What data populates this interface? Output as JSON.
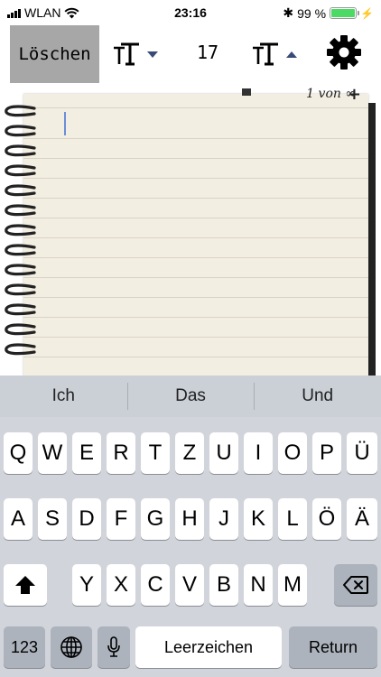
{
  "status_bar": {
    "carrier": "WLAN",
    "time": "23:16",
    "battery_percent": "99 %",
    "battery_level": 0.99
  },
  "toolbar": {
    "clear_label": "Löschen",
    "font_size": "17"
  },
  "notebook": {
    "page_indicator": "1 von ∞",
    "next_page": "+"
  },
  "keyboard": {
    "suggestions": [
      "Ich",
      "Das",
      "Und"
    ],
    "row1": [
      "Q",
      "W",
      "E",
      "R",
      "T",
      "Z",
      "U",
      "I",
      "O",
      "P",
      "Ü"
    ],
    "row2": [
      "A",
      "S",
      "D",
      "F",
      "G",
      "H",
      "J",
      "K",
      "L",
      "Ö",
      "Ä"
    ],
    "row3": [
      "Y",
      "X",
      "C",
      "V",
      "B",
      "N",
      "M"
    ],
    "numbers_label": "123",
    "space_label": "Leerzeichen",
    "return_label": "Return"
  },
  "colors": {
    "battery": "#4cd964",
    "clear_button_bg": "#a7a7a7",
    "keyboard_bg": "#d1d4da",
    "cursor": "#6b8cd6"
  }
}
